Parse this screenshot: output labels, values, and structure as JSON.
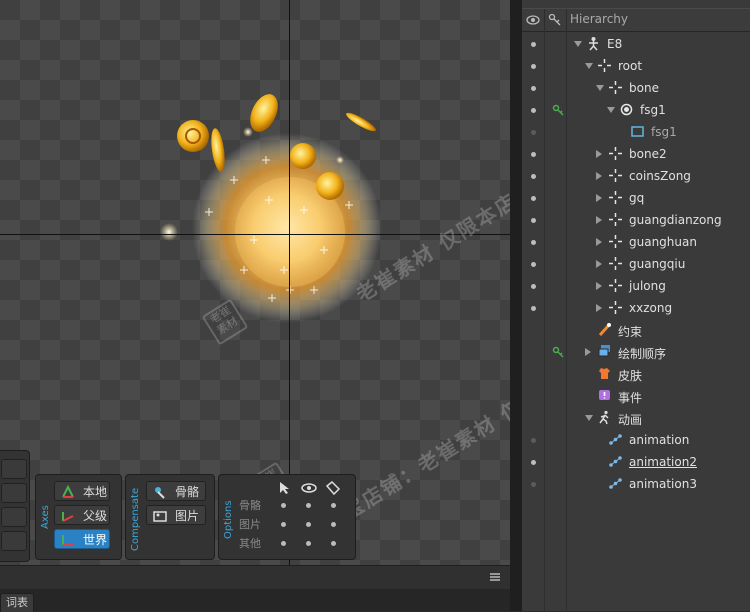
{
  "hierarchy": {
    "title": "Hierarchy",
    "items": [
      {
        "label": "E8",
        "icon": "skeleton-icon"
      },
      {
        "label": "root",
        "icon": "bone-icon"
      },
      {
        "label": "bone",
        "icon": "bone-icon"
      },
      {
        "label": "fsg1",
        "icon": "slot-icon"
      },
      {
        "label": "fsg1",
        "icon": "region-attachment-icon"
      },
      {
        "label": "bone2",
        "icon": "bone-icon"
      },
      {
        "label": "coinsZong",
        "icon": "bone-icon"
      },
      {
        "label": "gq",
        "icon": "bone-icon"
      },
      {
        "label": "guangdianzong",
        "icon": "bone-icon"
      },
      {
        "label": "guanghuan",
        "icon": "bone-icon"
      },
      {
        "label": "guangqiu",
        "icon": "bone-icon"
      },
      {
        "label": "julong",
        "icon": "bone-icon"
      },
      {
        "label": "xxzong",
        "icon": "bone-icon"
      },
      {
        "label": "约束",
        "icon": "constraints-icon"
      },
      {
        "label": "绘制顺序",
        "icon": "draw-order-icon"
      },
      {
        "label": "皮肤",
        "icon": "skins-icon"
      },
      {
        "label": "事件",
        "icon": "events-icon"
      },
      {
        "label": "动画",
        "icon": "animations-icon"
      },
      {
        "label": "animation",
        "icon": "animation-icon"
      },
      {
        "label": "animation2",
        "icon": "animation-icon"
      },
      {
        "label": "animation3",
        "icon": "animation-icon"
      }
    ]
  },
  "axes": {
    "label": "Axes",
    "buttons": [
      "本地",
      "父级",
      "世界"
    ],
    "active": "世界"
  },
  "compensate": {
    "label": "Compensate",
    "buttons": [
      "骨骼",
      "图片"
    ]
  },
  "options": {
    "label": "Options",
    "rows": [
      "骨骼",
      "图片",
      "其他"
    ]
  },
  "watermark": {
    "text1": "淘宝店铺：老崔素材  仅限本店咨询",
    "text2": "老崔素材  仅限本店咨询",
    "badge": "老崔素材"
  },
  "bottom_tab": "词表",
  "colors": {
    "accent": "#2a82c4",
    "label_blue": "#3ea6d8",
    "key_green": "#4caf50"
  }
}
